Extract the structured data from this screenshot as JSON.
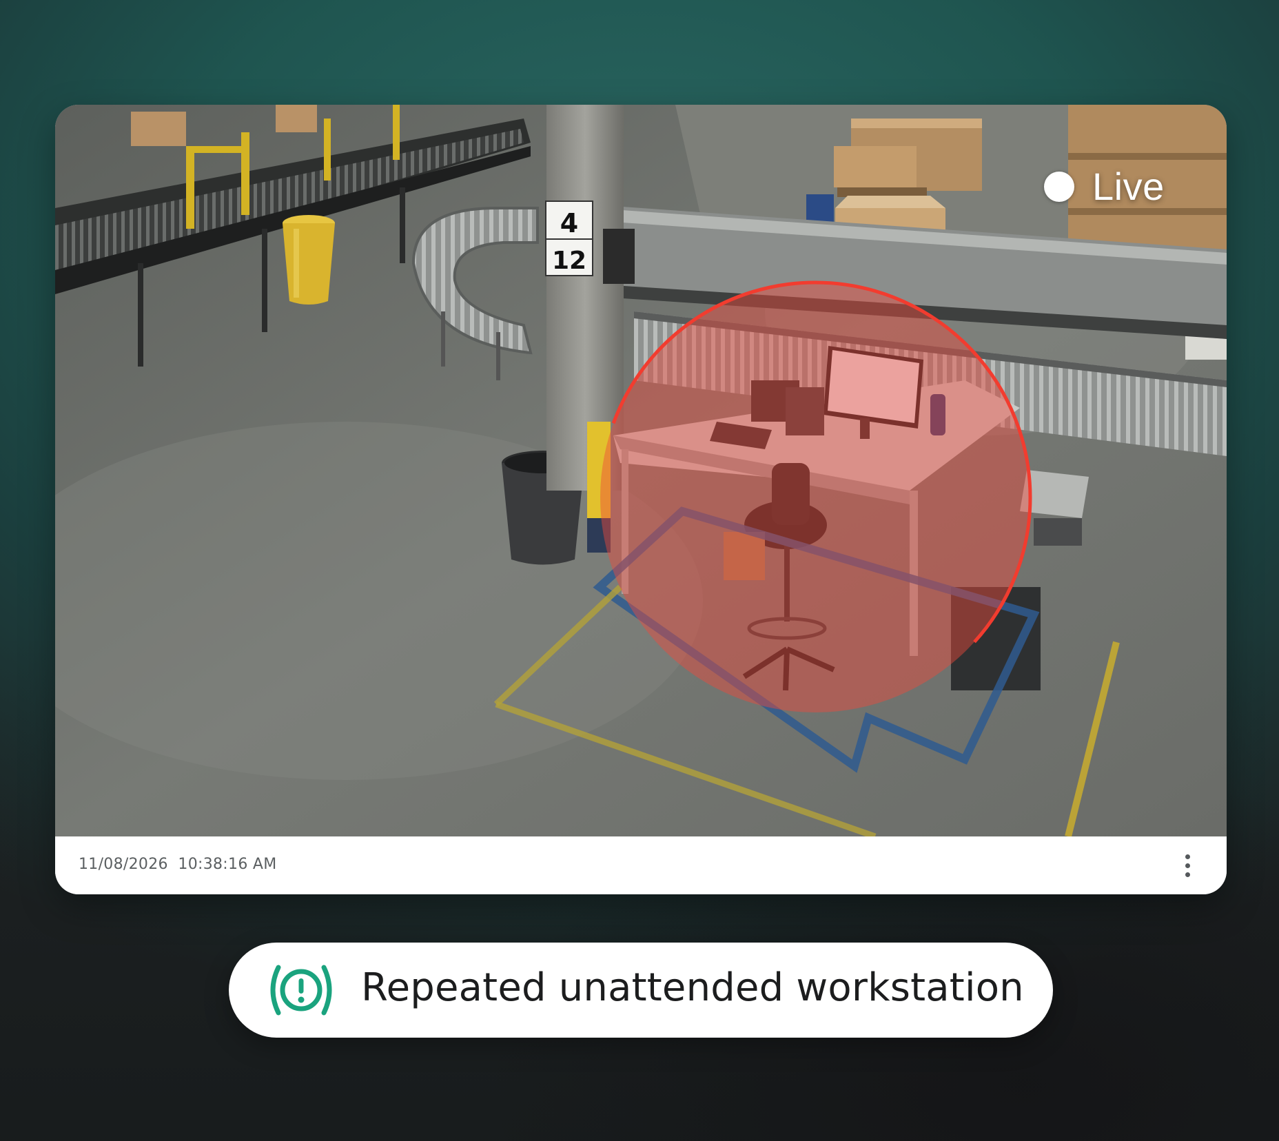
{
  "camera": {
    "live_label": "Live",
    "pillar_sign": {
      "top": "4",
      "bottom": "12"
    },
    "footer": {
      "date": "11/08/2026",
      "time": "10:38:16 AM"
    },
    "highlight_color": "#f03a2e",
    "more_icon": "more-vertical-icon"
  },
  "alert": {
    "icon": "alert-broadcast-icon",
    "icon_color": "#1aa37e",
    "text": "Repeated unattended workstation"
  },
  "colors": {
    "background": "#215a55",
    "card": "#ffffff"
  }
}
